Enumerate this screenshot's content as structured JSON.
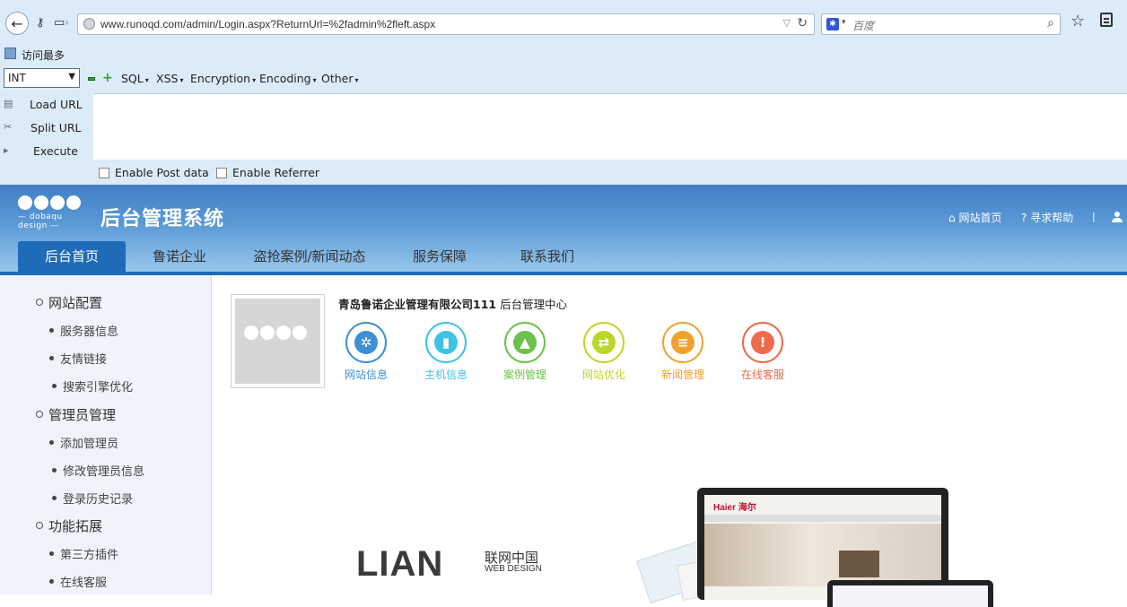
{
  "browser": {
    "url": "www.runoqd.com/admin/Login.aspx?ReturnUrl=%2fadmin%2fleft.aspx",
    "search_placeholder": "百度",
    "bookmark": "访问最多"
  },
  "hackbar": {
    "select_value": "INT",
    "menus": [
      "SQL",
      "XSS",
      "Encryption",
      "Encoding",
      "Other"
    ],
    "side": [
      "Load URL",
      "Split URL",
      "Execute"
    ],
    "enable_post": "Enable Post data",
    "enable_referrer": "Enable Referrer"
  },
  "site": {
    "logo_sub": "— dobaqu design —",
    "title": "后台管理系统",
    "home_link": "网站首页",
    "help_link": "寻求帮助",
    "separator": "|",
    "tabs": [
      "后台首页",
      "鲁诺企业",
      "盗抢案例/新闻动态",
      "服务保障",
      "联系我们"
    ]
  },
  "sidebar": {
    "groups": [
      {
        "label": "网站配置",
        "items": [
          "服务器信息",
          "友情链接",
          "搜索引擎优化"
        ]
      },
      {
        "label": "管理员管理",
        "items": [
          "添加管理员",
          "修改管理员信息",
          "登录历史记录"
        ]
      },
      {
        "label": "功能拓展",
        "items": [
          "第三方插件",
          "在线客服"
        ]
      }
    ]
  },
  "main": {
    "company_name": "青岛鲁诺企业管理有限公司111",
    "company_suffix": "后台管理中心",
    "quick_links": [
      {
        "label": "网站信息",
        "color": "#3d8fd6",
        "icon": "gear-icon"
      },
      {
        "label": "主机信息",
        "color": "#3ec3e6",
        "icon": "thermometer-icon"
      },
      {
        "label": "案例管理",
        "color": "#6cc24a",
        "icon": "chart-icon"
      },
      {
        "label": "网站优化",
        "color": "#b8d829",
        "icon": "refresh-icon"
      },
      {
        "label": "新闻管理",
        "color": "#f0a22e",
        "icon": "document-icon"
      },
      {
        "label": "在线客服",
        "color": "#ee6a4a",
        "icon": "alert-icon"
      }
    ],
    "banner_logo": "LIAN",
    "banner_cn": "联网中国",
    "banner_en": "WEB DESIGN",
    "monitor_brand": "Haier 海尔"
  },
  "colors": {
    "primary": "#1e6bb8",
    "sidebar_bg": "#eef4fa",
    "toolbar_bg": "#dcebf8"
  }
}
